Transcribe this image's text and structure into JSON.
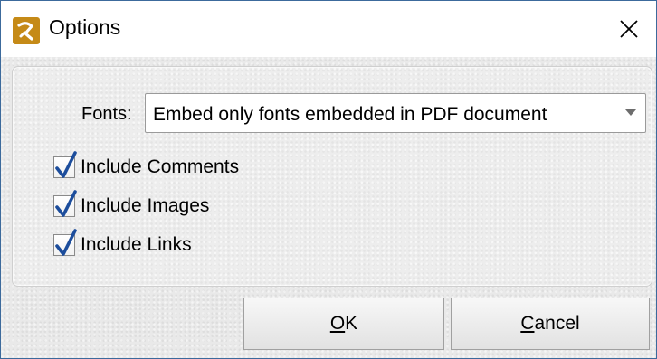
{
  "window": {
    "title": "Options",
    "icon": "pdf-xchange-logo-icon",
    "close_icon": "close-icon",
    "close_glyph": "✕"
  },
  "fonts": {
    "label": "Fonts:",
    "selected_value": "Embed only fonts embedded in PDF document",
    "dropdown_icon": "chevron-down-icon"
  },
  "options": [
    {
      "label": "Include Comments",
      "checked": true
    },
    {
      "label": "Include Images",
      "checked": true
    },
    {
      "label": "Include Links",
      "checked": true
    }
  ],
  "buttons": {
    "ok_mnemonic": "O",
    "ok_rest": "K",
    "cancel_mnemonic": "C",
    "cancel_rest": "ancel"
  },
  "colors": {
    "accent_check": "#1c4d9c",
    "app_icon": "#c58a17"
  }
}
